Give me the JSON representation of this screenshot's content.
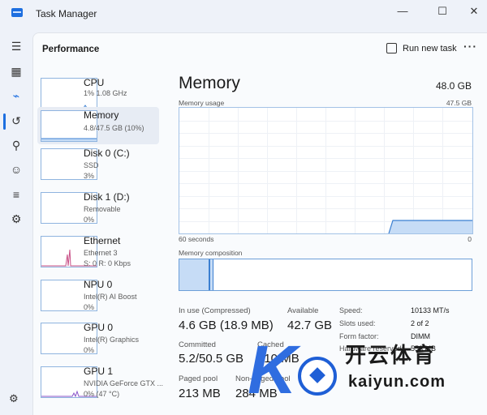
{
  "window": {
    "title": "Task Manager",
    "minimize_icon": "minimize-icon",
    "maximize_icon": "maximize-icon",
    "close_icon": "close-icon"
  },
  "nav": {
    "items": [
      {
        "icon": "hamburger-menu-icon",
        "glyph": "☰"
      },
      {
        "icon": "processes-icon",
        "glyph": "▦"
      },
      {
        "icon": "performance-icon",
        "glyph": "⌁"
      },
      {
        "icon": "app-history-icon",
        "glyph": "↺"
      },
      {
        "icon": "startup-apps-icon",
        "glyph": "⚲"
      },
      {
        "icon": "users-icon",
        "glyph": "☺"
      },
      {
        "icon": "details-icon",
        "glyph": "≡"
      },
      {
        "icon": "services-icon",
        "glyph": "⚙"
      }
    ],
    "settings_glyph": "⚙"
  },
  "header": {
    "title": "Performance",
    "run_task_label": "Run new task",
    "more_label": "···"
  },
  "tiles": [
    {
      "name": "CPU",
      "sub1": "1% 1.08 GHz",
      "sub2": "",
      "sub3": ""
    },
    {
      "name": "Memory",
      "sub1": "4.8/47.5 GB (10%)",
      "sub2": "",
      "sub3": ""
    },
    {
      "name": "Disk 0 (C:)",
      "sub1": "SSD",
      "sub2": "3%",
      "sub3": ""
    },
    {
      "name": "Disk 1 (D:)",
      "sub1": "Removable",
      "sub2": "0%",
      "sub3": ""
    },
    {
      "name": "Ethernet",
      "sub1": "Ethernet 3",
      "sub2": "S: 0 R: 0 Kbps",
      "sub3": ""
    },
    {
      "name": "NPU 0",
      "sub1": "Intel(R) AI Boost",
      "sub2": "0%",
      "sub3": ""
    },
    {
      "name": "GPU 0",
      "sub1": "Intel(R) Graphics",
      "sub2": "0%",
      "sub3": ""
    },
    {
      "name": "GPU 1",
      "sub1": "NVIDIA GeForce GTX ...",
      "sub2": "0% (47 °C)",
      "sub3": ""
    }
  ],
  "memory": {
    "title": "Memory",
    "total": "48.0 GB",
    "usage_label": "Memory usage",
    "usage_max": "47.5 GB",
    "axis_left": "60 seconds",
    "axis_right": "0",
    "composition_label": "Memory composition",
    "usage_fraction": 0.1,
    "stats": {
      "in_use_label": "In use (Compressed)",
      "in_use_value": "4.6 GB (18.9 MB)",
      "available_label": "Available",
      "available_value": "42.7 GB",
      "committed_label": "Committed",
      "committed_value": "5.2/50.5 GB",
      "cached_label": "Cached",
      "cached_value": "910 MB",
      "paged_pool_label": "Paged pool",
      "paged_pool_value": "213 MB",
      "non_paged_pool_label": "Non-paged pool",
      "non_paged_pool_value": "284 MB"
    },
    "details": [
      {
        "label": "Speed:",
        "value": "10133 MT/s"
      },
      {
        "label": "Slots used:",
        "value": "2 of 2"
      },
      {
        "label": "Form factor:",
        "value": "DIMM"
      },
      {
        "label": "Hardware reserved:",
        "value": "553 MB"
      }
    ]
  },
  "watermark": {
    "k_letter": "K",
    "cn_text": "开云体育",
    "en_text": "kaiyun.com"
  },
  "colors": {
    "accent": "#1d6fe0",
    "graph_border": "#a3c2e6",
    "graph_fill": "#c6dcf6"
  }
}
